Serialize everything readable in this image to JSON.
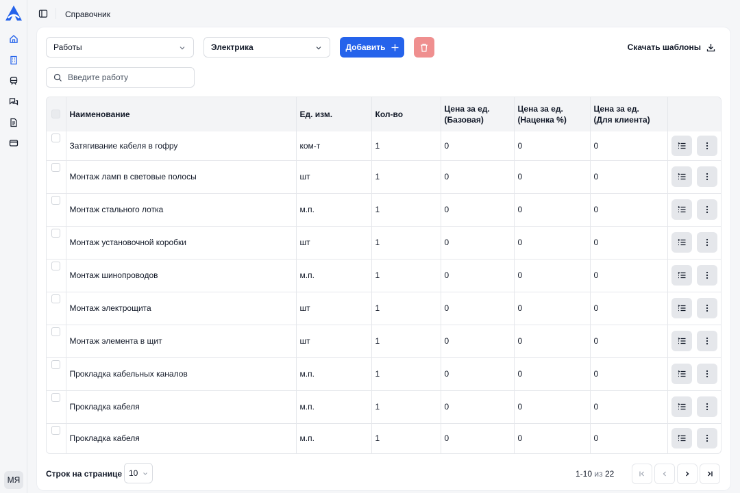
{
  "sidebar": {
    "logo": "logo-icon",
    "items": [
      {
        "icon": "home-icon"
      },
      {
        "icon": "building-icon"
      },
      {
        "icon": "train-icon"
      },
      {
        "icon": "chat-icon"
      },
      {
        "icon": "document-icon"
      },
      {
        "icon": "card-icon"
      }
    ],
    "avatar": "МЯ"
  },
  "header": {
    "breadcrumb": "Справочник"
  },
  "toolbar": {
    "type_select": "Работы",
    "category_select": "Электрика",
    "add_label": "Добавить",
    "download_label": "Скачать шаблоны",
    "search_placeholder": "Введите работу"
  },
  "table": {
    "columns": [
      "Наименование",
      "Ед. изм.",
      "Кол-во",
      "Цена за ед.\n(Базовая)",
      "Цена за ед.\n(Наценка %)",
      "Цена за ед.\n(Для клиента)"
    ],
    "rows": [
      [
        "Затягивание кабеля в гофру",
        "ком-т",
        "1",
        "0",
        "0",
        "0"
      ],
      [
        "Монтаж ламп в световые полосы",
        "шт",
        "1",
        "0",
        "0",
        "0"
      ],
      [
        "Монтаж стального лотка",
        "м.п.",
        "1",
        "0",
        "0",
        "0"
      ],
      [
        "Монтаж установочной коробки",
        "шт",
        "1",
        "0",
        "0",
        "0"
      ],
      [
        "Монтаж шинопроводов",
        "м.п.",
        "1",
        "0",
        "0",
        "0"
      ],
      [
        "Монтаж электрощита",
        "шт",
        "1",
        "0",
        "0",
        "0"
      ],
      [
        "Монтаж элемента в щит",
        "шт",
        "1",
        "0",
        "0",
        "0"
      ],
      [
        "Прокладка кабельных каналов",
        "м.п.",
        "1",
        "0",
        "0",
        "0"
      ],
      [
        "Прокладка кабеля",
        "м.п.",
        "1",
        "0",
        "0",
        "0"
      ],
      [
        "Прокладка кабеля",
        "м.п.",
        "1",
        "0",
        "0",
        "0"
      ]
    ]
  },
  "pagination": {
    "rows_label": "Строк на странице",
    "page_size": "10",
    "range": "1-10",
    "of_label": "из",
    "total": "22"
  },
  "colors": {
    "accent": "#2563eb",
    "danger": "#ef8f8f"
  }
}
